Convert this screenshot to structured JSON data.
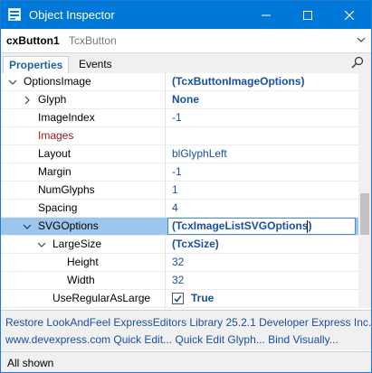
{
  "window": {
    "title": "Object Inspector"
  },
  "titlebar_controls": {
    "minimize": "minimize-icon",
    "maximize": "maximize-icon",
    "close": "close-icon"
  },
  "object": {
    "name": "cxButton1",
    "class": "TcxButton"
  },
  "tabs": [
    {
      "label": "Properties",
      "active": true
    },
    {
      "label": "Events",
      "active": false
    }
  ],
  "properties": [
    {
      "name": "OptionsImage",
      "value": "(TcxButtonImageOptions)",
      "expander": "expanded"
    },
    {
      "name": "Glyph",
      "value": "None",
      "expander": "collapsed"
    },
    {
      "name": "ImageIndex",
      "value": "-1"
    },
    {
      "name": "Images",
      "value": ""
    },
    {
      "name": "Layout",
      "value": "blGlyphLeft"
    },
    {
      "name": "Margin",
      "value": "-1"
    },
    {
      "name": "NumGlyphs",
      "value": "1"
    },
    {
      "name": "Spacing",
      "value": "4"
    },
    {
      "name": "SVGOptions",
      "value": "(TcxImageListSVGOptions)",
      "expander": "expanded",
      "selected": true
    },
    {
      "name": "LargeSize",
      "value": "(TcxSize)",
      "expander": "expanded"
    },
    {
      "name": "Height",
      "value": "32"
    },
    {
      "name": "Width",
      "value": "32"
    },
    {
      "name": "UseRegularAsLarge",
      "value": "True",
      "checked": true
    }
  ],
  "verbs": {
    "line1": "Restore LookAndFeel ExpressEditors Library 25.2.1 Developer Express Inc.",
    "line2": "www.devexpress.com Quick Edit... Quick Edit Glyph... Bind Visually..."
  },
  "status": {
    "text": "All shown"
  },
  "colors": {
    "titlebar": "#0078d7",
    "selection": "#9cc6ee",
    "value_text": "#1a4fa0",
    "images_name": "#8b1a1a"
  }
}
